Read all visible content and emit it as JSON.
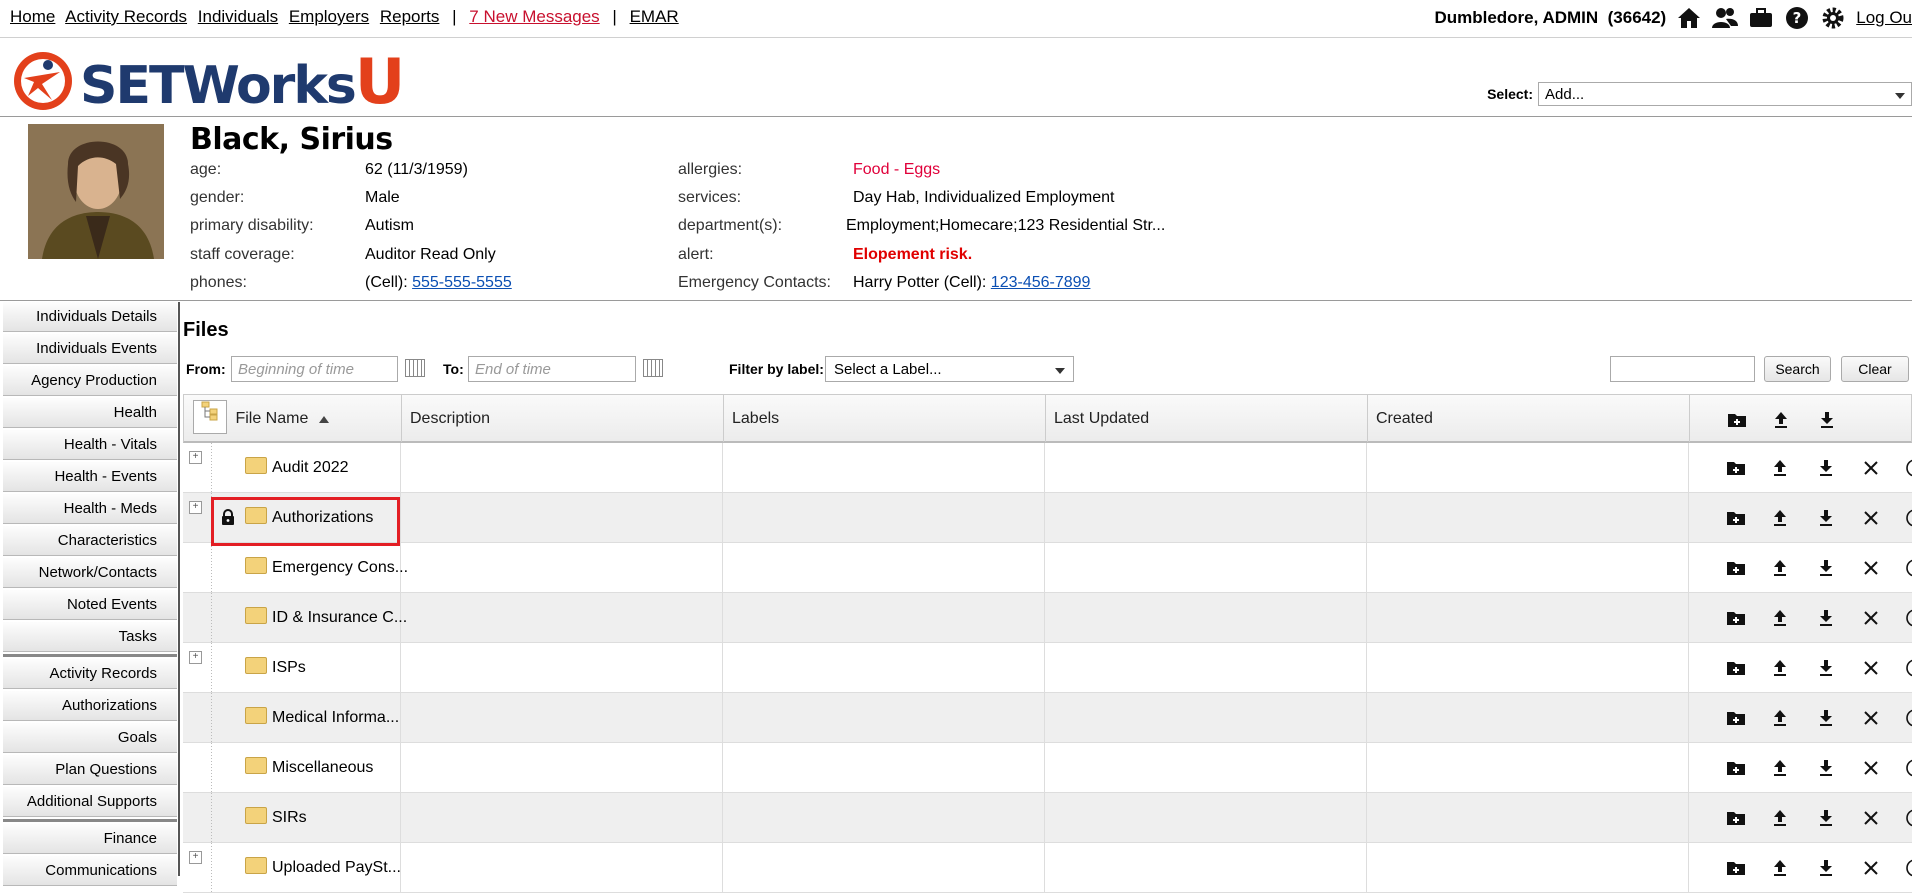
{
  "topnav": {
    "home": "Home",
    "activity_records": "Activity Records",
    "individuals": "Individuals",
    "employers": "Employers",
    "reports": "Reports",
    "sep": "|",
    "messages": "7 New Messages",
    "emar": "EMAR"
  },
  "user": {
    "name": "Dumbledore, ADMIN",
    "id": "(36642)",
    "logout": "Log Ou"
  },
  "logo": {
    "text": "SETWorks",
    "u": "U"
  },
  "select": {
    "label": "Select:",
    "value": "Add..."
  },
  "profile": {
    "name": "Black, Sirius",
    "left": [
      {
        "label": "age:",
        "value": "62 (11/3/1959)"
      },
      {
        "label": "gender:",
        "value": "Male"
      },
      {
        "label": "primary disability:",
        "value": "Autism"
      },
      {
        "label": "staff coverage:",
        "value": "Auditor Read Only"
      },
      {
        "label": "phones:",
        "value_prefix": "(Cell): ",
        "value_link": "555-555-5555"
      }
    ],
    "right": [
      {
        "label": "allergies:",
        "value": "Food - Eggs"
      },
      {
        "label": "services:",
        "value": "Day Hab, Individualized Employment"
      },
      {
        "label": "department(s):",
        "value": "Employment;Homecare;123 Residential Str..."
      },
      {
        "label": "alert:",
        "value": "Elopement risk."
      },
      {
        "label": "Emergency Contacts:",
        "value_prefix": "Harry Potter (Cell): ",
        "value_link": "123-456-7899"
      }
    ]
  },
  "sidebar": {
    "items": [
      "Individuals Details",
      "Individuals Events",
      "Agency Production",
      "Health",
      "Health - Vitals",
      "Health - Events",
      "Health - Meds",
      "Characteristics",
      "Network/Contacts",
      "Noted Events",
      "Tasks",
      "Activity Records",
      "Authorizations",
      "Goals",
      "Plan Questions",
      "Additional Supports",
      "Finance",
      "Communications"
    ]
  },
  "files": {
    "title": "Files",
    "from_label": "From:",
    "from_placeholder": "Beginning of time",
    "to_label": "To:",
    "to_placeholder": "End of time",
    "filter_label": "Filter by label:",
    "filter_value": "Select a Label...",
    "search_label": "Search",
    "clear_label": "Clear",
    "columns": [
      "File Name",
      "Description",
      "Labels",
      "Last Updated",
      "Created"
    ],
    "rows": [
      {
        "name": "Audit 2022",
        "expandable": true,
        "locked": false
      },
      {
        "name": "Authorizations",
        "expandable": true,
        "locked": true
      },
      {
        "name": "Emergency Cons...",
        "expandable": false,
        "locked": false
      },
      {
        "name": "ID & Insurance C...",
        "expandable": false,
        "locked": false
      },
      {
        "name": "ISPs",
        "expandable": true,
        "locked": false
      },
      {
        "name": "Medical Informa...",
        "expandable": false,
        "locked": false
      },
      {
        "name": "Miscellaneous",
        "expandable": false,
        "locked": false
      },
      {
        "name": "SIRs",
        "expandable": false,
        "locked": false
      },
      {
        "name": "Uploaded PaySt...",
        "expandable": true,
        "locked": false
      }
    ]
  },
  "colors": {
    "highlight": "#e31e24",
    "alert": "#e00000",
    "link": "#0b4fb3",
    "logo_blue": "#1f3a6e",
    "logo_red": "#e3401b"
  }
}
